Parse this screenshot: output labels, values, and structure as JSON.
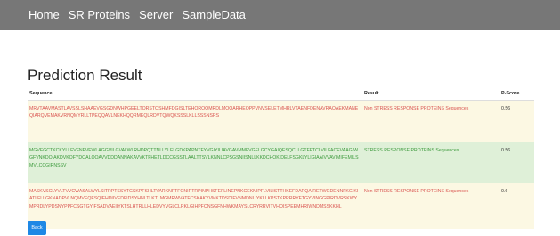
{
  "nav": {
    "items": [
      {
        "label": "Home"
      },
      {
        "label": "SR Proteins"
      },
      {
        "label": "Server"
      },
      {
        "label": "SampleData"
      }
    ]
  },
  "page": {
    "title": "Prediction Result"
  },
  "table": {
    "headers": {
      "sequence": "Sequence",
      "result": "Result",
      "score": "P-Score"
    },
    "rows": [
      {
        "sequence": "MRVTAAVMASTLAVSSLSHAAEVGSGDNWHPGEELTQRSTQSHMFDGISLTEHQRQQMRDLMQQARHEQPPVNVSELETMHRLVTAENFDENAVRAQAEKMANEQIARQVEMAKVRNQMYRLLTPEQQAVLNEKHQQRMEQLRDVTQWQKSSSLKLLSSSNSRS",
        "result": "Non STRESS RESPONSE PROTEINS Sequences",
        "score": "0.56",
        "status": "negative"
      },
      {
        "sequence": "MGVEGCTKCKYLLFVFNFVFWLAGGVILGVALWLRHDPQTTNLLYLELGDKPAPNTFYVGIYILIAVGAVMMFVGFLGCYGAIQESQCLLGTFFTCLVILFACEVAAGIWGFVNKDQIAKDVKQFYDQALQQAVVDDDANNAKAVVKTFHETLDCCGSSTLAALTTSVLKNNLCPSGSNIISNLLKKDCHQKIDELFSGKLYLIGIAAIVVAVIMIFEMILSMVLCCGIRNSSV",
        "result": "STRESS RESPONSE PROTEINS Sequences",
        "score": "0.56",
        "status": "positive"
      },
      {
        "sequence": "MASKVSCLYVLTVVCWASALWYLSITRPTSSYTGSKPFSHLTVARKNFTFGNIRTRPINPHSFEFLINEPNKCEKNIPFLVILISTTHKEFDARQAIRETWGDENNFKGIKIATLFLLGKNADPVLNQMVEQESQIFHDIIVEDFIDSYHNLTLKTLMGMRWVATFCSKAKYVMKTDSDIFVNMDNLIYKLLKPSTKPRRRYFTGYVINGGPIRDVRSKWYMPRDLYPDSNYPPFCSGTGYIFSADVAEIIYKTSLHTRLLHLEDVYVGLCLRKLGIHPFQNSGFNHWKMAYSLCRYRRVITVHQISPEEMHRIWNDMSSKKHL",
        "result": "Non STRESS RESPONSE PROTEINS Sequences",
        "score": "0.6",
        "status": "negative"
      }
    ]
  },
  "back_label": "Back",
  "colors": {
    "navbar_bg": "#777777",
    "negative_row_bg": "#fcf8e3",
    "negative_text": "#d9534f",
    "positive_row_bg": "#dff0d8",
    "positive_text": "#3c9a3c",
    "button_bg": "#1e88e5"
  }
}
